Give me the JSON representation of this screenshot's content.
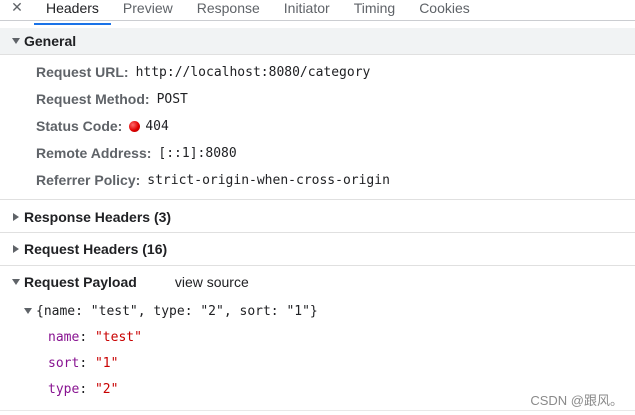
{
  "tabs": [
    {
      "label": "Headers",
      "active": true
    },
    {
      "label": "Preview",
      "active": false
    },
    {
      "label": "Response",
      "active": false
    },
    {
      "label": "Initiator",
      "active": false
    },
    {
      "label": "Timing",
      "active": false
    },
    {
      "label": "Cookies",
      "active": false
    }
  ],
  "close_glyph": "✕",
  "general": {
    "title": "General",
    "rows": {
      "request_url": {
        "label": "Request URL:",
        "value": "http://localhost:8080/category"
      },
      "request_method": {
        "label": "Request Method:",
        "value": "POST"
      },
      "status_code": {
        "label": "Status Code:",
        "value": "404",
        "status_color": "#e00000"
      },
      "remote_address": {
        "label": "Remote Address:",
        "value": "[::1]:8080"
      },
      "referrer_policy": {
        "label": "Referrer Policy:",
        "value": "strict-origin-when-cross-origin"
      }
    }
  },
  "response_headers": {
    "title": "Response Headers (3)"
  },
  "request_headers": {
    "title": "Request Headers (16)"
  },
  "request_payload": {
    "title": "Request Payload",
    "view_source": "view source",
    "summary": "{name: \"test\", type: \"2\", sort: \"1\"}",
    "props": [
      {
        "key": "name",
        "sep": ": ",
        "value": "\"test\""
      },
      {
        "key": "sort",
        "sep": ": ",
        "value": "\"1\""
      },
      {
        "key": "type",
        "sep": ": ",
        "value": "\"2\""
      }
    ]
  },
  "watermark": "CSDN @跟风。",
  "colors": {
    "accent": "#1a73e8",
    "key": "#881391",
    "string": "#c80000"
  }
}
